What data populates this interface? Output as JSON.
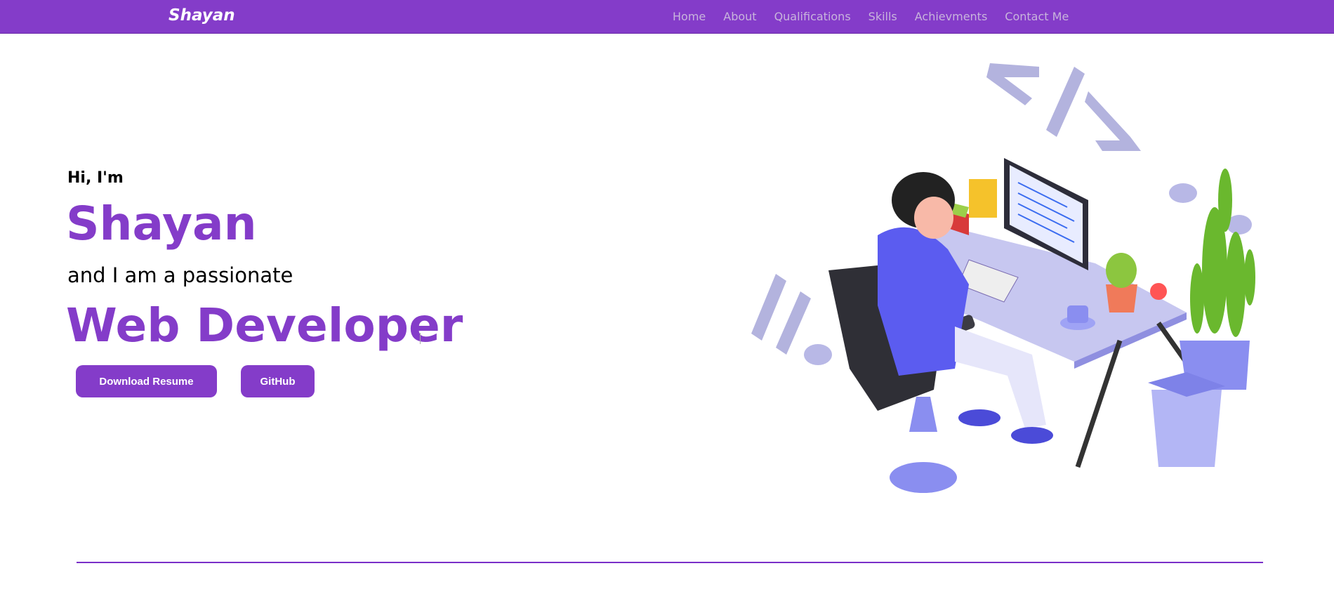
{
  "nav": {
    "logo": "Shayan",
    "items": [
      "Home",
      "About",
      "Qualifications",
      "Skills",
      "Achievments",
      "Contact Me"
    ]
  },
  "hero": {
    "greeting": "Hi, I'm",
    "name": "Shayan",
    "tagline": "and I am a passionate",
    "role": "Web Developer",
    "buttons": {
      "resume": "Download Resume",
      "github": "GitHub"
    }
  },
  "colors": {
    "accent": "#843cc9"
  },
  "illustration": "developer-at-desk-illustration"
}
